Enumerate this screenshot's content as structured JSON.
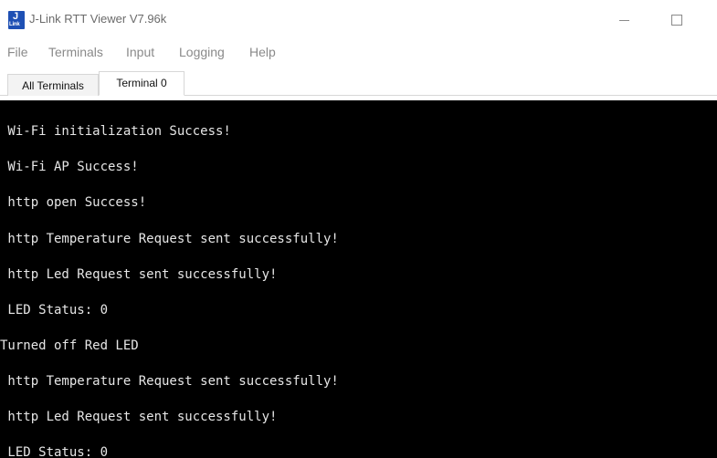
{
  "window": {
    "title": "J-Link RTT Viewer V7.96k",
    "icon_letter": "J",
    "icon_sub": "Link"
  },
  "menu": {
    "items": [
      "File",
      "Terminals",
      "Input",
      "Logging",
      "Help"
    ]
  },
  "tabs": [
    {
      "label": "All Terminals",
      "selected": false
    },
    {
      "label": "Terminal 0",
      "selected": true
    }
  ],
  "terminal": {
    "background": "#000000",
    "foreground": "#e6e6e6",
    "lines": [
      " Wi-Fi initialization Success!",
      " Wi-Fi AP Success!",
      " http open Success!",
      " http Temperature Request sent successfully!",
      " http Led Request sent successfully!",
      " LED Status: 0",
      "Turned off Red LED",
      " http Temperature Request sent successfully!",
      " http Led Request sent successfully!",
      " LED Status: 0"
    ]
  },
  "colors": {
    "icon_blue": "#1e50b4",
    "menu_text": "#8a8a8a",
    "title_text": "#6b6b6b"
  }
}
